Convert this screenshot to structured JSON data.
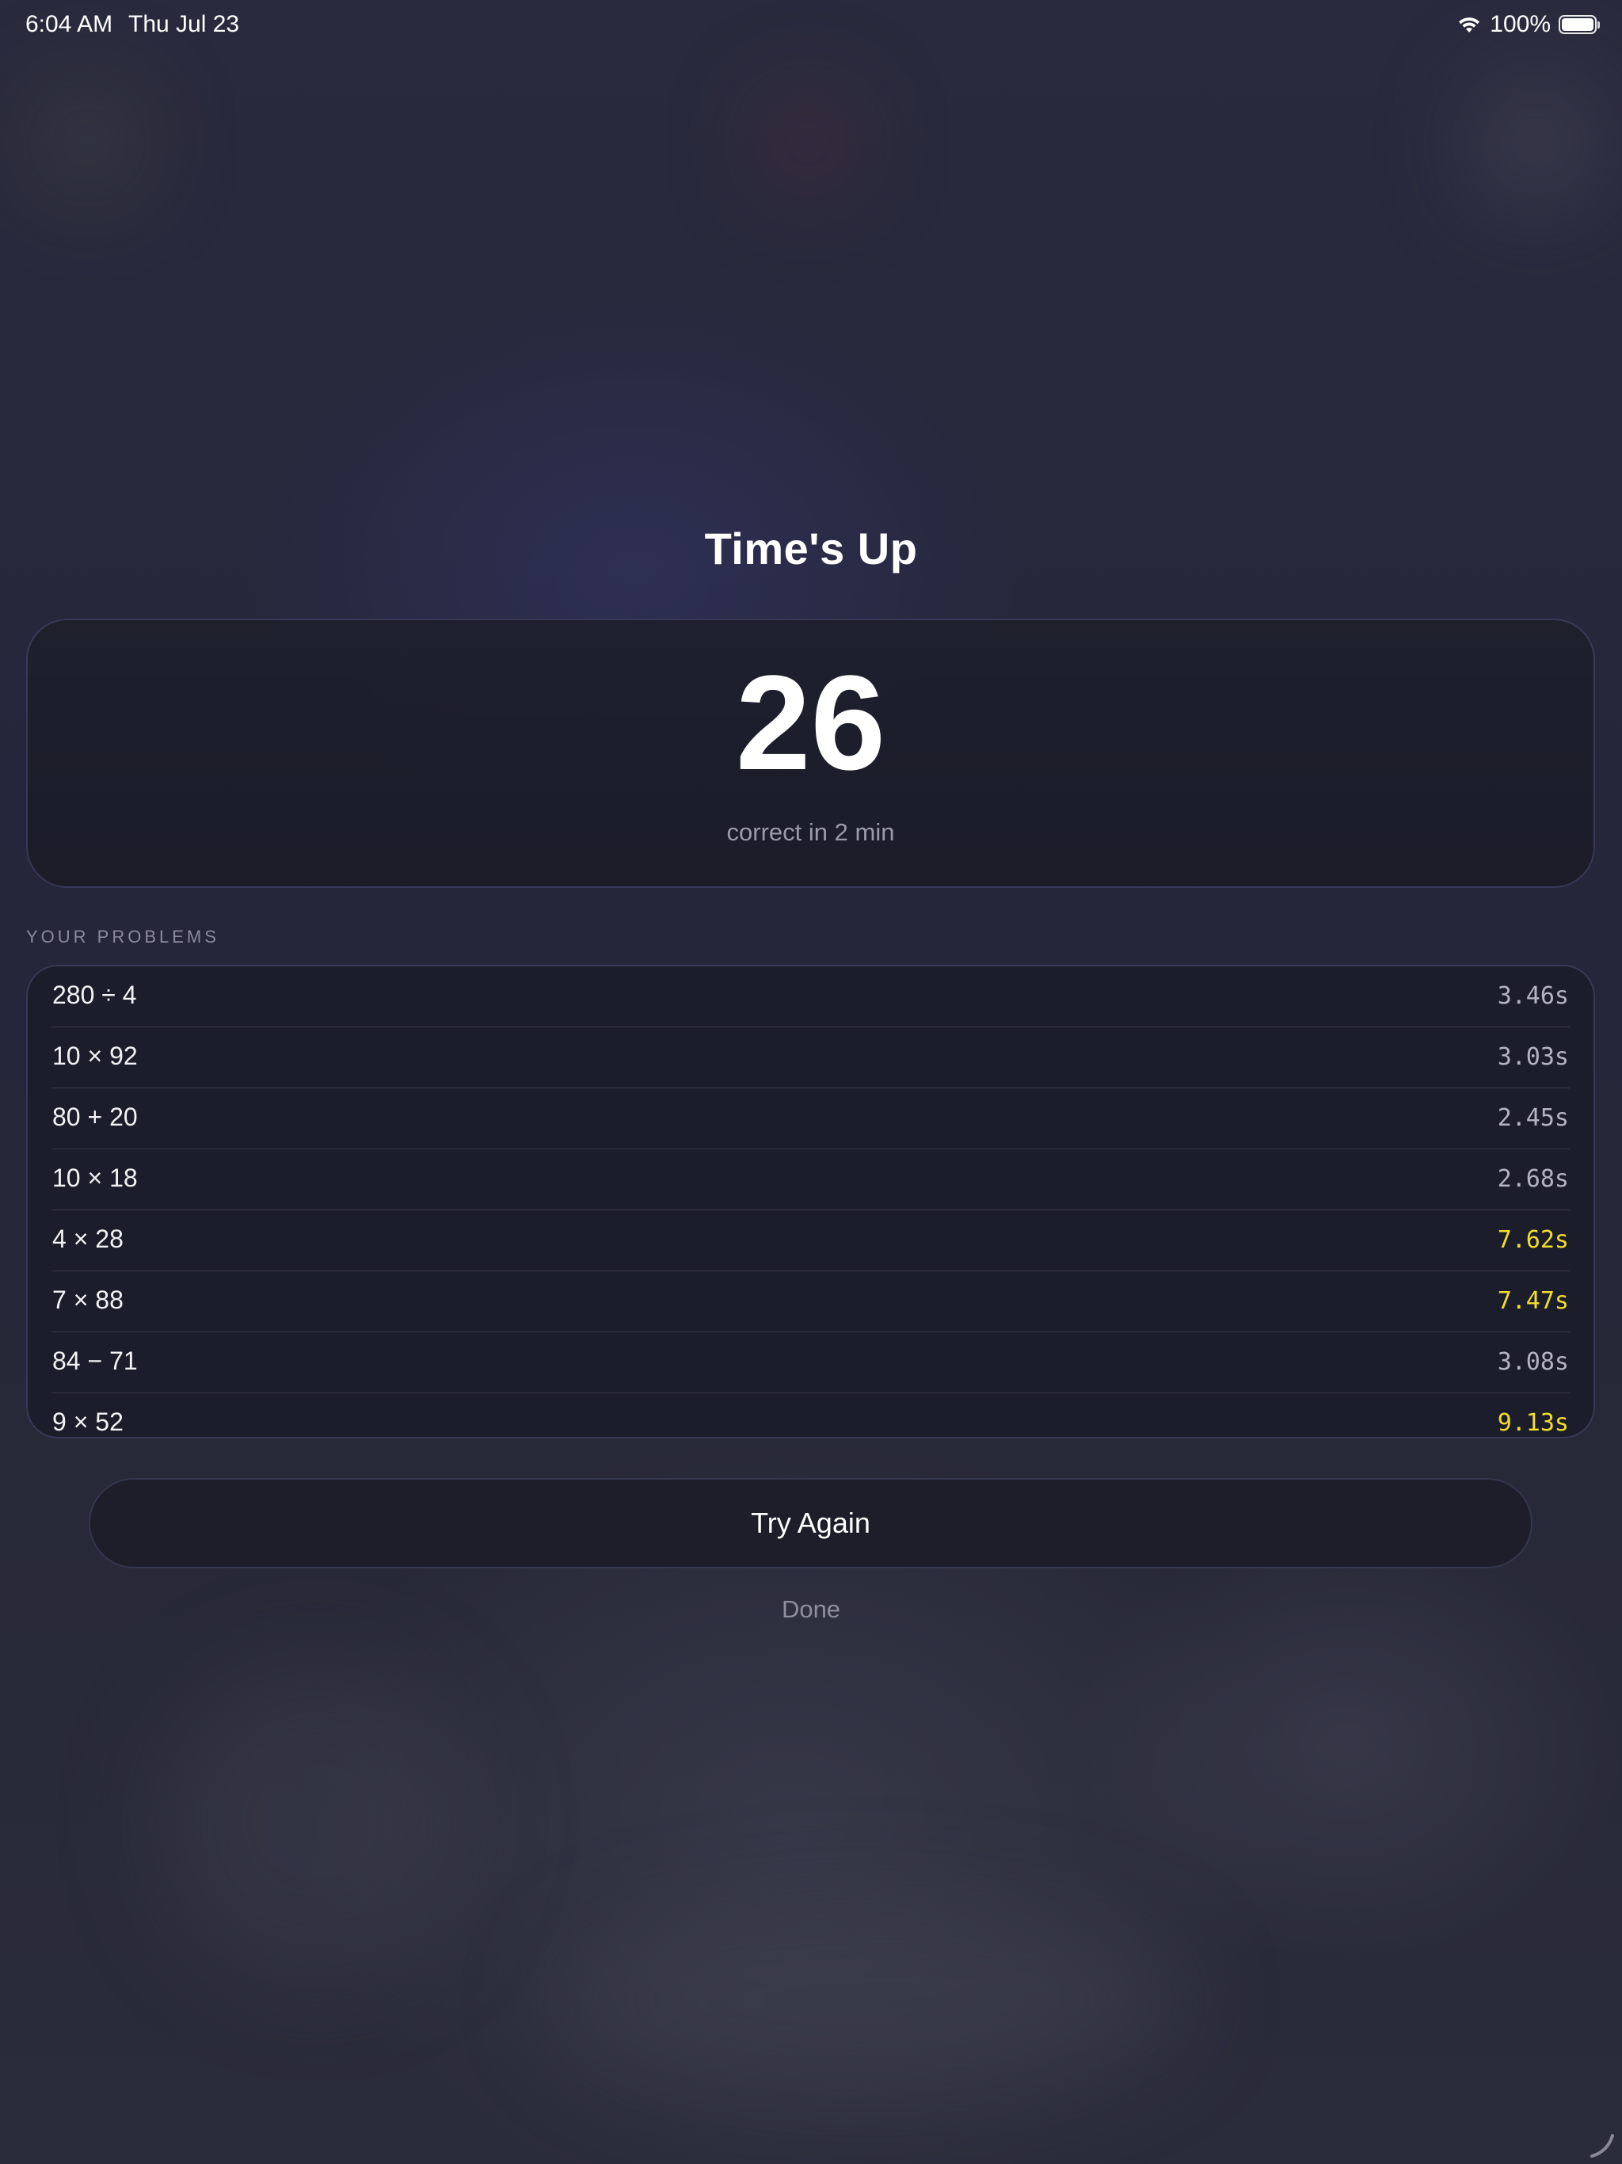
{
  "status_bar": {
    "time": "6:04 AM",
    "date": "Thu Jul 23",
    "battery": "100%",
    "wifi_icon": "wifi-icon",
    "battery_icon": "battery-icon"
  },
  "title": "Time's Up",
  "score": {
    "value": "26",
    "caption": "correct in 2 min"
  },
  "problems_section_label": "YOUR PROBLEMS",
  "problems": [
    {
      "expr": "280 ÷ 4",
      "time": "3.46s",
      "slow": false
    },
    {
      "expr": "10 × 92",
      "time": "3.03s",
      "slow": false
    },
    {
      "expr": "80 + 20",
      "time": "2.45s",
      "slow": false
    },
    {
      "expr": "10 × 18",
      "time": "2.68s",
      "slow": false
    },
    {
      "expr": "4 × 28",
      "time": "7.62s",
      "slow": true
    },
    {
      "expr": "7 × 88",
      "time": "7.47s",
      "slow": true
    },
    {
      "expr": "84 − 71",
      "time": "3.08s",
      "slow": false
    },
    {
      "expr": "9 × 52",
      "time": "9.13s",
      "slow": true
    }
  ],
  "buttons": {
    "try_again": "Try Again",
    "done": "Done"
  },
  "colors": {
    "slow_time": "#f3dd2a",
    "normal_time": "#b4b4c0",
    "background": "#26273a"
  }
}
